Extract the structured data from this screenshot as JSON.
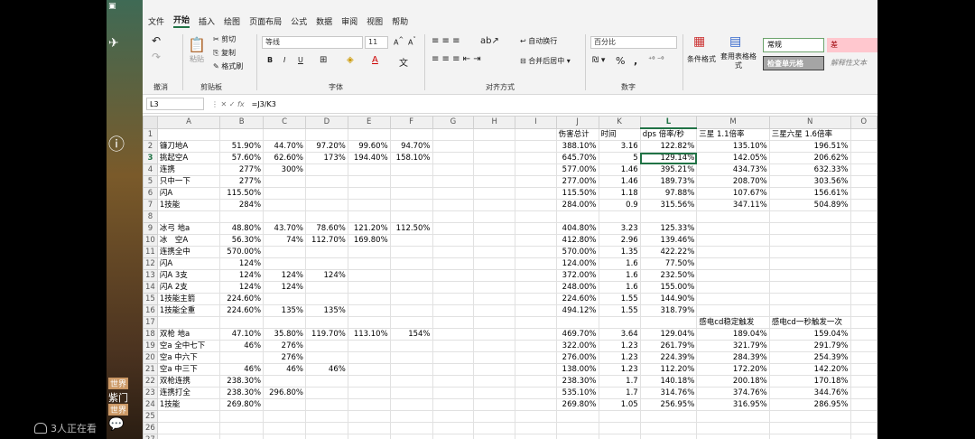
{
  "overlay": {
    "watching": "3人正在看",
    "side_items": [
      "世界",
      "世界",
      "紫门",
      "世界"
    ]
  },
  "menu": {
    "tabs": [
      "文件",
      "开始",
      "插入",
      "绘图",
      "页面布局",
      "公式",
      "数据",
      "审阅",
      "视图",
      "帮助"
    ],
    "active": "开始"
  },
  "ribbon": {
    "clipboard": {
      "paste": "粘贴",
      "cut": "剪切",
      "copy": "复制",
      "format_painter": "格式刷",
      "group": "剪贴板",
      "undo_group": "撤消"
    },
    "font": {
      "name": "等线",
      "size": "11",
      "bold": "B",
      "italic": "I",
      "underline": "U",
      "group": "字体",
      "grow": "A^",
      "shrink": "A˅"
    },
    "alignment": {
      "wrap": "自动换行",
      "merge": "合并后居中",
      "group": "对齐方式"
    },
    "number": {
      "format": "百分比",
      "percent": "%",
      "comma": ",",
      "group": "数字"
    },
    "styles": {
      "conditional": "条件格式",
      "table": "套用表格格式",
      "normal": "常规",
      "bad": "差",
      "check": "检查单元格",
      "explanatory": "解释性文本"
    }
  },
  "formula_bar": {
    "name_box": "L3",
    "formula": "=J3/K3"
  },
  "sheet": {
    "columns": [
      "A",
      "B",
      "C",
      "D",
      "E",
      "F",
      "G",
      "H",
      "I",
      "J",
      "K",
      "L",
      "M",
      "N",
      "O"
    ],
    "active_cell": "L3",
    "rows": [
      [
        "1",
        "",
        "",
        "",
        "",
        "",
        "",
        "",
        "",
        "",
        "伤害总计",
        "时间",
        "dps 倍率/秒",
        "三星 1.1倍率",
        "三星六星 1.6倍率",
        ""
      ],
      [
        "2",
        "镰刀地A",
        "51.90%",
        "44.70%",
        "97.20%",
        "99.60%",
        "94.70%",
        "",
        "",
        "",
        "388.10%",
        "3.16",
        "122.82%",
        "135.10%",
        "196.51%",
        ""
      ],
      [
        "3",
        "挑起空A",
        "57.60%",
        "62.60%",
        "173%",
        "194.40%",
        "158.10%",
        "",
        "",
        "",
        "645.70%",
        "5",
        "129.14%",
        "142.05%",
        "206.62%",
        ""
      ],
      [
        "4",
        "连携",
        "277%",
        "300%",
        "",
        "",
        "",
        "",
        "",
        "",
        "577.00%",
        "1.46",
        "395.21%",
        "434.73%",
        "632.33%",
        ""
      ],
      [
        "5",
        "只中一下",
        "277%",
        "",
        "",
        "",
        "",
        "",
        "",
        "",
        "277.00%",
        "1.46",
        "189.73%",
        "208.70%",
        "303.56%",
        ""
      ],
      [
        "6",
        "闪A",
        "115.50%",
        "",
        "",
        "",
        "",
        "",
        "",
        "",
        "115.50%",
        "1.18",
        "97.88%",
        "107.67%",
        "156.61%",
        ""
      ],
      [
        "7",
        "1技能",
        "284%",
        "",
        "",
        "",
        "",
        "",
        "",
        "",
        "284.00%",
        "0.9",
        "315.56%",
        "347.11%",
        "504.89%",
        ""
      ],
      [
        "8",
        "",
        "",
        "",
        "",
        "",
        "",
        "",
        "",
        "",
        "",
        "",
        "",
        "",
        "",
        ""
      ],
      [
        "9",
        "冰弓 地a",
        "48.80%",
        "43.70%",
        "78.60%",
        "121.20%",
        "112.50%",
        "",
        "",
        "",
        "404.80%",
        "3.23",
        "125.33%",
        "",
        "",
        ""
      ],
      [
        "10",
        "冰　空A",
        "56.30%",
        "74%",
        "112.70%",
        "169.80%",
        "",
        "",
        "",
        "",
        "412.80%",
        "2.96",
        "139.46%",
        "",
        "",
        ""
      ],
      [
        "11",
        "连携全中",
        "570.00%",
        "",
        "",
        "",
        "",
        "",
        "",
        "",
        "570.00%",
        "1.35",
        "422.22%",
        "",
        "",
        ""
      ],
      [
        "12",
        "闪A",
        "124%",
        "",
        "",
        "",
        "",
        "",
        "",
        "",
        "124.00%",
        "1.6",
        "77.50%",
        "",
        "",
        ""
      ],
      [
        "13",
        "闪A 3支",
        "124%",
        "124%",
        "124%",
        "",
        "",
        "",
        "",
        "",
        "372.00%",
        "1.6",
        "232.50%",
        "",
        "",
        ""
      ],
      [
        "14",
        "闪A 2支",
        "124%",
        "124%",
        "",
        "",
        "",
        "",
        "",
        "",
        "248.00%",
        "1.6",
        "155.00%",
        "",
        "",
        ""
      ],
      [
        "15",
        "1技能主箭",
        "224.60%",
        "",
        "",
        "",
        "",
        "",
        "",
        "",
        "224.60%",
        "1.55",
        "144.90%",
        "",
        "",
        ""
      ],
      [
        "16",
        "1技能全重",
        "224.60%",
        "135%",
        "135%",
        "",
        "",
        "",
        "",
        "",
        "494.12%",
        "1.55",
        "318.79%",
        "",
        "",
        ""
      ],
      [
        "17",
        "",
        "",
        "",
        "",
        "",
        "",
        "",
        "",
        "",
        "",
        "",
        "",
        "感电cd稳定触发",
        "感电cd一秒触发一次",
        ""
      ],
      [
        "18",
        "双枪 地a",
        "47.10%",
        "35.80%",
        "119.70%",
        "113.10%",
        "154%",
        "",
        "",
        "",
        "469.70%",
        "3.64",
        "129.04%",
        "189.04%",
        "159.04%",
        ""
      ],
      [
        "19",
        "空a 全中七下",
        "46%",
        "276%",
        "",
        "",
        "",
        "",
        "",
        "",
        "322.00%",
        "1.23",
        "261.79%",
        "321.79%",
        "291.79%",
        ""
      ],
      [
        "20",
        "空a 中六下",
        "",
        "276%",
        "",
        "",
        "",
        "",
        "",
        "",
        "276.00%",
        "1.23",
        "224.39%",
        "284.39%",
        "254.39%",
        ""
      ],
      [
        "21",
        "空a 中三下",
        "46%",
        "46%",
        "46%",
        "",
        "",
        "",
        "",
        "",
        "138.00%",
        "1.23",
        "112.20%",
        "172.20%",
        "142.20%",
        ""
      ],
      [
        "22",
        "双枪连携",
        "238.30%",
        "",
        "",
        "",
        "",
        "",
        "",
        "",
        "238.30%",
        "1.7",
        "140.18%",
        "200.18%",
        "170.18%",
        ""
      ],
      [
        "23",
        "连携打全",
        "238.30%",
        "296.80%",
        "",
        "",
        "",
        "",
        "",
        "",
        "535.10%",
        "1.7",
        "314.76%",
        "374.76%",
        "344.76%",
        ""
      ],
      [
        "24",
        "1技能",
        "269.80%",
        "",
        "",
        "",
        "",
        "",
        "",
        "",
        "269.80%",
        "1.05",
        "256.95%",
        "316.95%",
        "286.95%",
        ""
      ],
      [
        "25",
        "",
        "",
        "",
        "",
        "",
        "",
        "",
        "",
        "",
        "",
        "",
        "",
        "",
        "",
        ""
      ],
      [
        "26",
        "",
        "",
        "",
        "",
        "",
        "",
        "",
        "",
        "",
        "",
        "",
        "",
        "",
        "",
        ""
      ],
      [
        "27",
        "",
        "",
        "",
        "",
        "",
        "",
        "",
        "",
        "",
        "",
        "",
        "",
        "",
        "",
        ""
      ]
    ]
  }
}
